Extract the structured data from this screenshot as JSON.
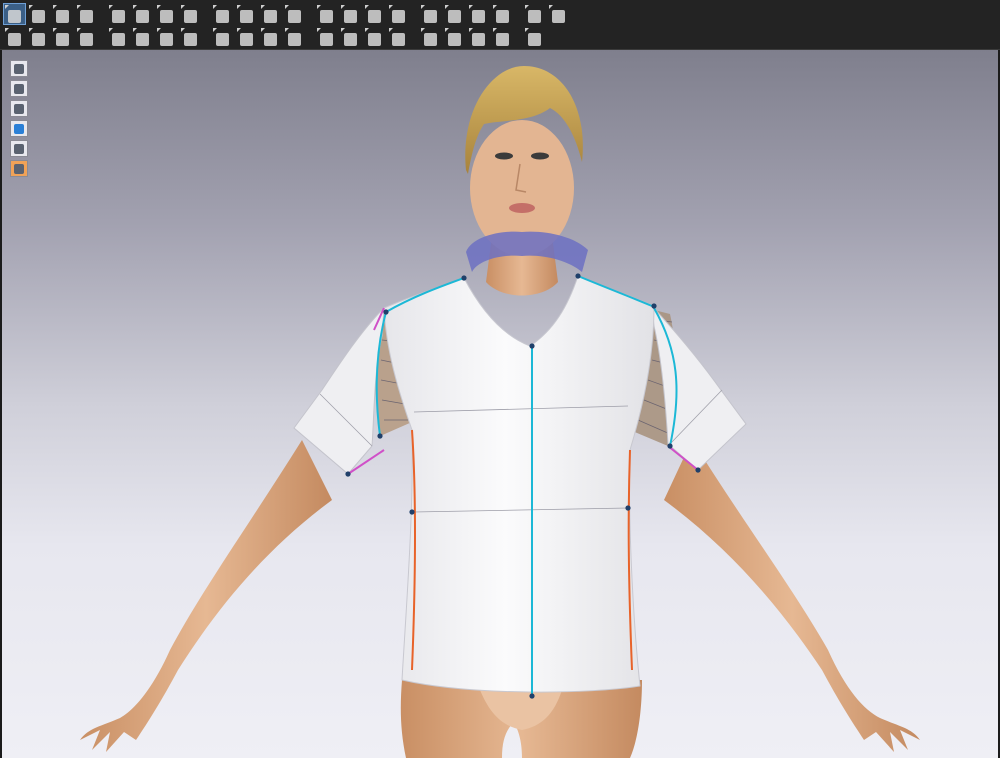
{
  "app": {
    "toolbar": {
      "row1": [
        "select-icon",
        "move-icon",
        "rectangle-icon",
        "transform-icon",
        "edit-icon",
        "undo-pattern-icon",
        "seam-icon",
        "fold-icon",
        "pen-icon",
        "dart-icon",
        "shirt-icon",
        "split-shirt-icon",
        "sleeve-icon",
        "arrange-icon",
        "tack-icon",
        "flip-icon",
        "sewing-icon",
        "bind-icon",
        "symmetry-icon",
        "pleat-icon",
        "curve-icon",
        "measure-icon"
      ],
      "row2": [
        "avatar-move-icon",
        "pin-icon",
        "pin-remove-icon",
        "pin-cut-icon",
        "fold-arrange-icon",
        "zipper-icon",
        "button-icon",
        "buttonhole-icon",
        "topstitch-icon",
        "ruler-icon",
        "tape-icon",
        "grain-icon",
        "texture-icon",
        "graphic-icon",
        "fabric-icon",
        "trim-icon",
        "transfer-icon",
        "fit-icon",
        "layer-icon",
        "turn-icon",
        "animate-icon"
      ]
    },
    "active_tool": "select-icon",
    "viewport_tools": [
      "avatar-icon",
      "brush-icon",
      "person-icon",
      "texture-view-icon",
      "wire-view-icon",
      "skin-icon"
    ],
    "colors": {
      "background_top": "#7f7f8d",
      "background_bottom": "#efeff5",
      "garment": "#f4f4f6",
      "seam_center": "#1cb8d6",
      "seam_side": "#e8632a",
      "seam_sleeve": "#d050c8",
      "skin": "#dfb08c",
      "hair": "#c9a55a",
      "collar_handle": "#6c70c2"
    }
  }
}
